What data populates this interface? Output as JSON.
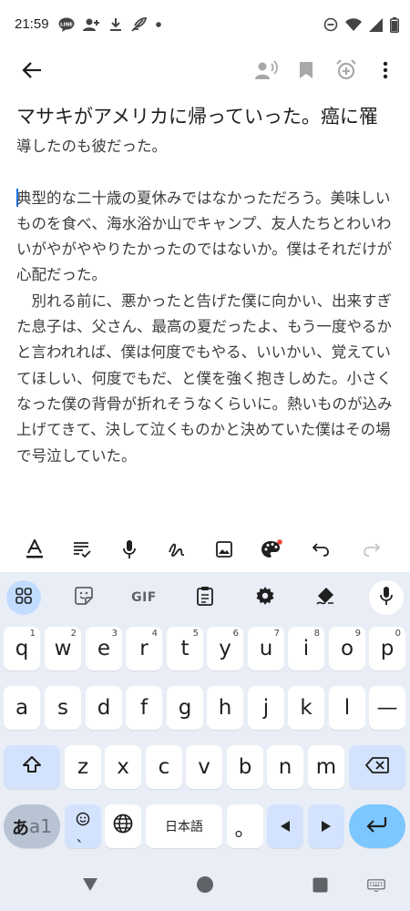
{
  "status_bar": {
    "time": "21:59",
    "left_icons": [
      "line-icon",
      "person-add-icon",
      "download-icon",
      "feather-icon",
      "dot-icon"
    ],
    "right_icons": [
      "dnd-icon",
      "wifi-icon",
      "signal-icon",
      "battery-icon"
    ]
  },
  "app_bar": {
    "icons": [
      "back-arrow-icon",
      "voice-icon",
      "bookmark-icon",
      "reminder-icon",
      "more-vert-icon"
    ]
  },
  "note": {
    "title": "マサキがアメリカに帰っていった。癌に罹",
    "paragraphs": [
      "導したのも彼だった。",
      "",
      "典型的な二十歳の夏休みではなかっただろう。美味しいものを食べ、海水浴か山でキャンプ、友人たちとわいわいがやがややりたかったのではないか。僕はそれだけが心配だった。",
      "　別れる前に、悪かったと告げた僕に向かい、出来すぎた息子は、父さん、最高の夏だったよ、もう一度やるかと言われれば、僕は何度でもやる、いいかい、覚えていてほしい、何度でもだ、と僕を強く抱きしめた。小さくなった僕の背骨が折れそうなくらいに。熱いものが込み上げてきて、決して泣くものかと決めていた僕はその場で号泣していた。"
    ]
  },
  "format_toolbar": {
    "icons": [
      "text-format-icon",
      "checklist-icon",
      "mic-icon",
      "draw-icon",
      "image-icon",
      "palette-icon",
      "undo-icon",
      "redo-icon"
    ]
  },
  "keyboard": {
    "top_row": {
      "gif_label": "GIF",
      "icons": [
        "apps-grid-icon",
        "sticker-icon",
        "clipboard-icon",
        "settings-icon",
        "handwriting-icon",
        "mic-icon"
      ]
    },
    "row1": [
      {
        "label": "q",
        "hint": "1"
      },
      {
        "label": "w",
        "hint": "2"
      },
      {
        "label": "e",
        "hint": "3"
      },
      {
        "label": "r",
        "hint": "4"
      },
      {
        "label": "t",
        "hint": "5"
      },
      {
        "label": "y",
        "hint": "6"
      },
      {
        "label": "u",
        "hint": "7"
      },
      {
        "label": "i",
        "hint": "8"
      },
      {
        "label": "o",
        "hint": "9"
      },
      {
        "label": "p",
        "hint": "0"
      }
    ],
    "row2": [
      "a",
      "s",
      "d",
      "f",
      "g",
      "h",
      "j",
      "k",
      "l",
      "—"
    ],
    "row3": [
      "z",
      "x",
      "c",
      "v",
      "b",
      "n",
      "m"
    ],
    "row4": {
      "lang_label_main": "あ",
      "lang_label_sub": "a1",
      "emoji_sub": "、",
      "space_label": "日本語",
      "period_label": "。"
    }
  },
  "nav_bar": {
    "icons": [
      "nav-back-icon",
      "nav-home-icon",
      "nav-recents-icon",
      "keyboard-switch-icon"
    ]
  },
  "colors": {
    "keyboard_bg": "#e9eef6",
    "function_key": "#d3e3fd",
    "enter_key": "#7cc7ff",
    "cursor": "#1a73e8",
    "palette_dot": "#ea4335"
  }
}
